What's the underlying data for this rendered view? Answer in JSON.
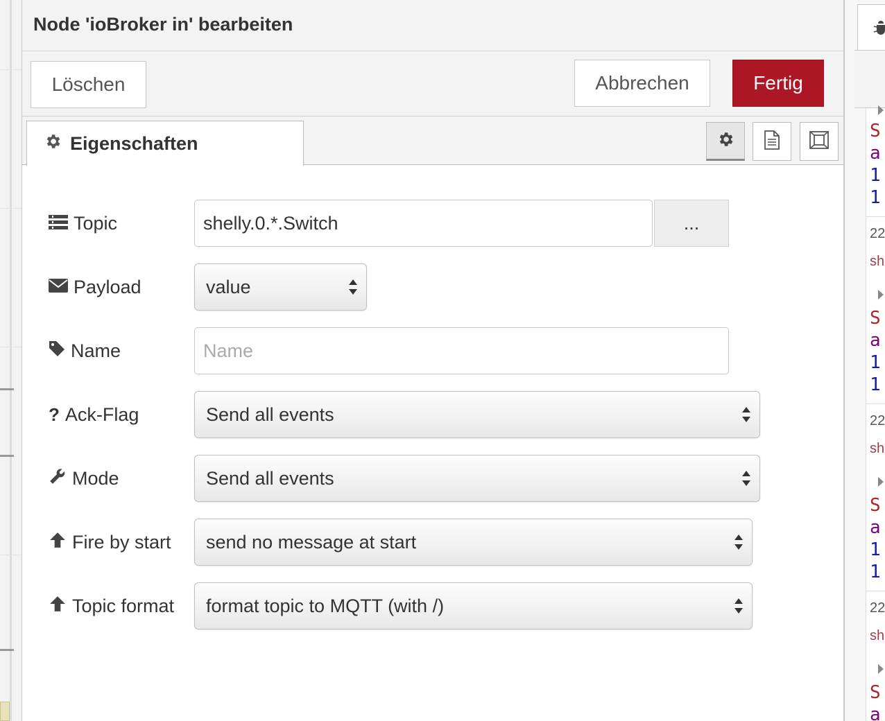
{
  "dialog": {
    "title": "Node 'ioBroker in' bearbeiten",
    "buttons": {
      "delete": "Löschen",
      "cancel": "Abbrechen",
      "done": "Fertig"
    },
    "accent_color": "#ad1625",
    "tab": {
      "label": "Eigenschaften",
      "icon": "gear-icon"
    },
    "tab_icons": [
      "gear-icon",
      "document-icon",
      "frame-icon"
    ]
  },
  "form": {
    "topic": {
      "label": "Topic",
      "value": "shelly.0.*.Switch",
      "picker": "..."
    },
    "payload": {
      "label": "Payload",
      "selected": "value"
    },
    "name": {
      "label": "Name",
      "value": "",
      "placeholder": "Name"
    },
    "ack_flag": {
      "label": "Ack-Flag",
      "selected": "Send all events"
    },
    "mode": {
      "label": "Mode",
      "selected": "Send all events"
    },
    "fire_by_start": {
      "label": "Fire by start",
      "selected": "send no message at start"
    },
    "topic_format": {
      "label": "Topic format",
      "selected": "format topic to MQTT (with /)"
    }
  },
  "sidebar": {
    "lines": [
      {
        "text": "S",
        "color": "#b22222"
      },
      {
        "text": "a",
        "color": "#800080"
      },
      {
        "text": "1",
        "color": "#1a1aa6"
      },
      {
        "text": "1",
        "color": "#1a1aa6"
      },
      {
        "text": "22",
        "color": "#555555"
      },
      {
        "text": "sh",
        "color": "#a0404a"
      },
      {
        "text": "S",
        "color": "#b22222"
      },
      {
        "text": "a",
        "color": "#800080"
      },
      {
        "text": "1",
        "color": "#1a1aa6"
      },
      {
        "text": "1",
        "color": "#1a1aa6"
      },
      {
        "text": "22",
        "color": "#555555"
      },
      {
        "text": "sh",
        "color": "#a0404a"
      },
      {
        "text": "S",
        "color": "#b22222"
      },
      {
        "text": "a",
        "color": "#800080"
      },
      {
        "text": "1",
        "color": "#1a1aa6"
      },
      {
        "text": "1",
        "color": "#1a1aa6"
      },
      {
        "text": "22",
        "color": "#555555"
      },
      {
        "text": "sh",
        "color": "#a0404a"
      },
      {
        "text": "S",
        "color": "#b22222"
      },
      {
        "text": "a",
        "color": "#800080"
      }
    ]
  }
}
